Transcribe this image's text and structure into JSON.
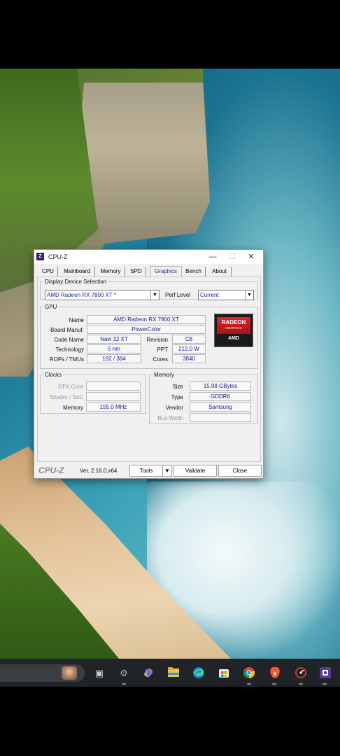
{
  "window": {
    "title": "CPU-Z",
    "icon_label": "Z",
    "controls": {
      "minimize": "—",
      "maximize": "☐",
      "close": "✕"
    }
  },
  "tabs": [
    {
      "label": "CPU"
    },
    {
      "label": "Mainboard"
    },
    {
      "label": "Memory"
    },
    {
      "label": "SPD"
    },
    {
      "label": "Graphics",
      "active": true
    },
    {
      "label": "Bench"
    },
    {
      "label": "About"
    }
  ],
  "display_selection": {
    "legend": "Display Device Selection",
    "device": "AMD Radeon RX 7800 XT *",
    "perf_label": "Perf Level",
    "perf_value": "Current"
  },
  "gpu": {
    "legend": "GPU",
    "name_label": "Name",
    "name": "AMD Radeon RX 7800 XT",
    "manuf_label": "Board Manuf.",
    "manuf": "PowerColor",
    "code_label": "Code Name",
    "code": "Navi 32 XT",
    "revision_label": "Revision",
    "revision": "C8",
    "tech_label": "Technology",
    "tech": "5 nm",
    "ppt_label": "PPT",
    "ppt": "212.0 W",
    "rops_label": "ROPs / TMUs",
    "rops": "192 / 384",
    "cores_label": "Cores",
    "cores": "3840",
    "logo": {
      "line1": "RADEON",
      "line2": "GRAPHICS",
      "line3": "AMD"
    }
  },
  "clocks": {
    "legend": "Clocks",
    "gfx_label": "GFX Core",
    "gfx": "",
    "shader_label": "Shader / SoC",
    "shader": "",
    "memory_label": "Memory",
    "memory": "155.0 MHz"
  },
  "memory": {
    "legend": "Memory",
    "size_label": "Size",
    "size": "15.98 GBytes",
    "type_label": "Type",
    "type": "GDDR6",
    "vendor_label": "Vendor",
    "vendor": "Samsung",
    "bus_label": "Bus Width",
    "bus": ""
  },
  "footer": {
    "brand": "CPU-Z",
    "version": "Ver. 2.16.0.x64",
    "tools": "Tools",
    "validate": "Validate",
    "close": "Close"
  },
  "taskbar": {
    "icons": [
      "task-view-icon",
      "settings-icon",
      "copilot-icon",
      "file-explorer-icon",
      "edge-icon",
      "store-icon",
      "chrome-icon",
      "brave-icon",
      "cpu-temp-icon",
      "cpuz-icon"
    ]
  }
}
